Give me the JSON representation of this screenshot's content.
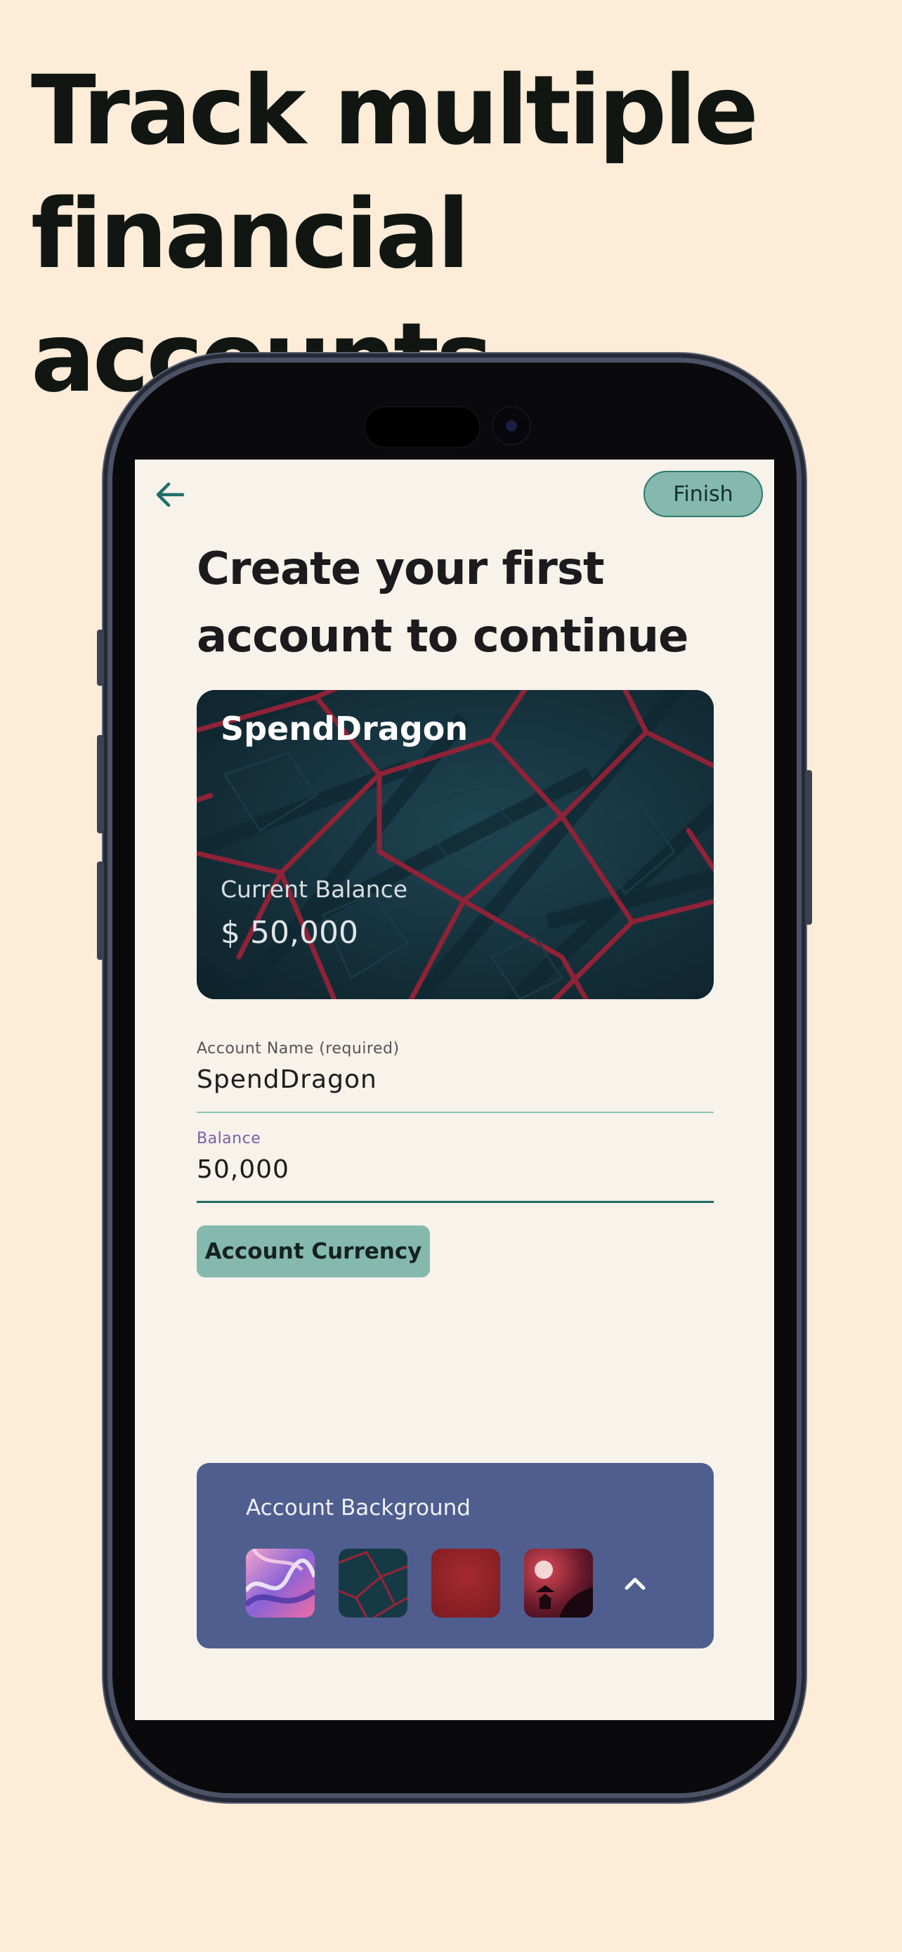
{
  "headline": {
    "line1": "Track multiple",
    "line2": "financial accounts"
  },
  "app": {
    "finish_label": "Finish",
    "title_line1": "Create your first",
    "title_line2": "account to continue",
    "card": {
      "name": "SpendDragon",
      "balance_label": "Current Balance",
      "balance_value": "$ 50,000"
    },
    "account_name": {
      "label": "Account Name (required)",
      "value": "SpendDragon"
    },
    "balance": {
      "label": "Balance",
      "value": "50,000"
    },
    "currency_button": "Account Currency",
    "background_panel": {
      "title": "Account Background",
      "options": [
        "abstract-swirl",
        "teal-red-lattice",
        "crimson-texture",
        "moonlit-pagoda"
      ]
    }
  },
  "colors": {
    "page_bg": "#fcecd8",
    "screen_bg": "#f7f2ea",
    "accent": "#85b9ae",
    "accent_dark": "#1d6b63",
    "panel": "#4f5e8f",
    "balance_label": "#7b5fa8"
  }
}
